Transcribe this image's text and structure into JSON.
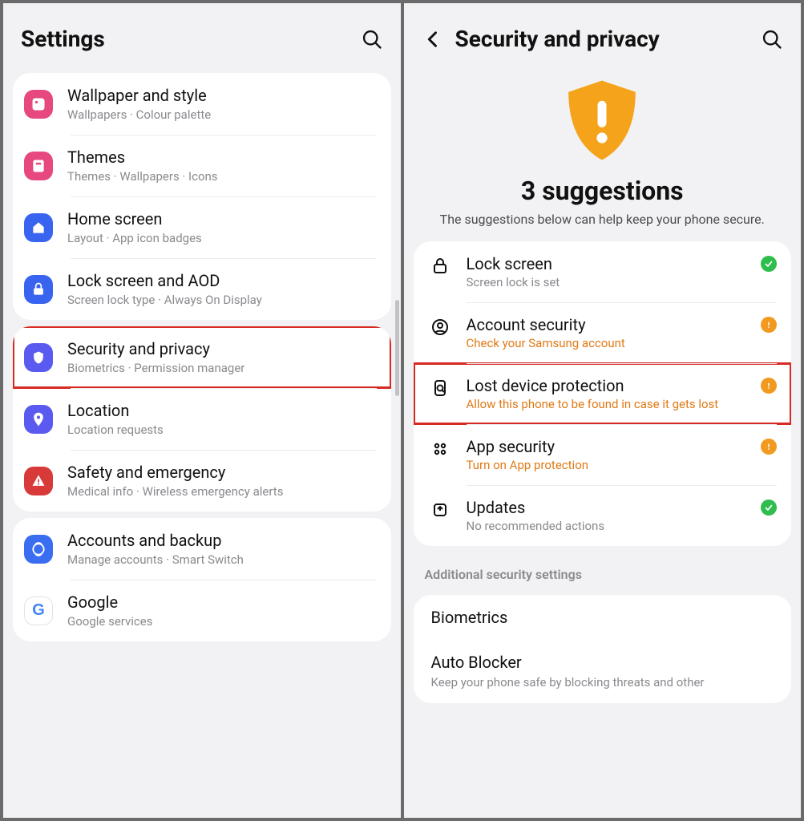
{
  "left": {
    "title": "Settings",
    "groups": [
      [
        {
          "icon": "wallpaper",
          "color": "pink",
          "title": "Wallpaper and style",
          "sub": "Wallpapers  ·  Colour palette"
        },
        {
          "icon": "themes",
          "color": "pink",
          "title": "Themes",
          "sub": "Themes  ·  Wallpapers  ·  Icons"
        },
        {
          "icon": "home",
          "color": "blue",
          "title": "Home screen",
          "sub": "Layout  ·  App icon badges"
        },
        {
          "icon": "lock",
          "color": "blue",
          "title": "Lock screen and AOD",
          "sub": "Screen lock type  ·  Always On Display"
        }
      ],
      [
        {
          "icon": "shield",
          "color": "indigo",
          "title": "Security and privacy",
          "sub": "Biometrics  ·  Permission manager",
          "highlight": true
        },
        {
          "icon": "location",
          "color": "indigo",
          "title": "Location",
          "sub": "Location requests"
        },
        {
          "icon": "emergency",
          "color": "red",
          "title": "Safety and emergency",
          "sub": "Medical info  ·  Wireless emergency alerts"
        }
      ],
      [
        {
          "icon": "accounts",
          "color": "blue2",
          "title": "Accounts and backup",
          "sub": "Manage accounts  ·  Smart Switch"
        },
        {
          "icon": "google",
          "color": "google",
          "title": "Google",
          "sub": "Google services"
        }
      ]
    ]
  },
  "right": {
    "title": "Security and privacy",
    "suggestions_title": "3 suggestions",
    "suggestions_sub": "The suggestions below can help keep your phone secure.",
    "items": [
      {
        "icon": "lock",
        "title": "Lock screen",
        "sub": "Screen lock is set",
        "sub_style": "gray",
        "status": "green"
      },
      {
        "icon": "account",
        "title": "Account security",
        "sub": "Check your Samsung account",
        "sub_style": "orange",
        "status": "orange"
      },
      {
        "icon": "find",
        "title": "Lost device protection",
        "sub": "Allow this phone to be found in case it gets lost",
        "sub_style": "orange",
        "status": "orange",
        "highlight": true
      },
      {
        "icon": "apps",
        "title": "App security",
        "sub": "Turn on App protection",
        "sub_style": "orange",
        "status": "orange"
      },
      {
        "icon": "updates",
        "title": "Updates",
        "sub": "No recommended actions",
        "sub_style": "gray",
        "status": "green"
      }
    ],
    "section_label": "Additional security settings",
    "extra": [
      {
        "title": "Biometrics"
      },
      {
        "title": "Auto Blocker",
        "sub": "Keep your phone safe by blocking threats and other"
      }
    ]
  }
}
